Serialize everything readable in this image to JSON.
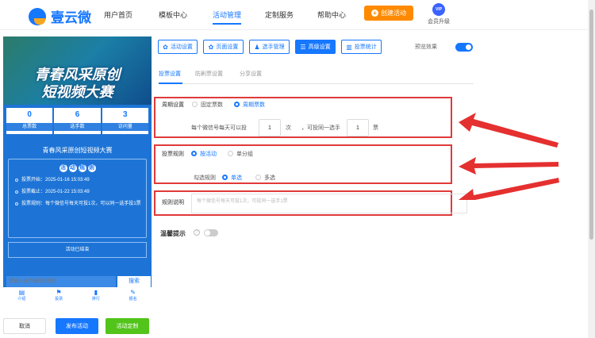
{
  "brand": {
    "name": "壹云微"
  },
  "nav": [
    {
      "label": "用户首页",
      "active": false
    },
    {
      "label": "模板中心",
      "active": false
    },
    {
      "label": "活动管理",
      "active": true
    },
    {
      "label": "定制服务",
      "active": false
    },
    {
      "label": "帮助中心",
      "active": false
    }
  ],
  "create_button": "创建活动",
  "vip": {
    "badge": "VIP",
    "label": "会员升级"
  },
  "preview": {
    "banner_line1": "青春风采原创",
    "banner_line2": "短视频大赛",
    "stats": [
      {
        "value": "0",
        "label": "总票数"
      },
      {
        "value": "6",
        "label": "选手数"
      },
      {
        "value": "3",
        "label": "访问量"
      }
    ],
    "activity_title": "青春风采原创短视频大赛",
    "rules_heading": [
      "活",
      "动",
      "规",
      "则"
    ],
    "rules": [
      "投票开始：2025-01-16 15:03:49",
      "投票截止：2025-01-22 15:03:49",
      "投票规则：每个微信号每天可投1次，可以同一选手投1票"
    ],
    "ended_text": "活动已结束",
    "search_placeholder": "请输入选手编号或名称",
    "search_button": "搜索",
    "bottom_nav": [
      {
        "icon": "▤",
        "label": "介绍"
      },
      {
        "icon": "⚑",
        "label": "投票"
      },
      {
        "icon": "▮",
        "label": "排行"
      },
      {
        "icon": "✎",
        "label": "报名"
      }
    ]
  },
  "actions": {
    "cancel": "取消",
    "publish": "发布活动",
    "customize": "活动定制"
  },
  "tabs": [
    {
      "label": "活动设置",
      "icon": "✿",
      "selected": false
    },
    {
      "label": "页面设置",
      "icon": "✿",
      "selected": false
    },
    {
      "label": "选手管理",
      "icon": "♟",
      "selected": false
    },
    {
      "label": "高级设置",
      "icon": "☰",
      "selected": true
    },
    {
      "label": "投票统计",
      "icon": "▥",
      "selected": false
    }
  ],
  "preview_toggle_label": "预览效果",
  "subtabs": [
    {
      "label": "投票设置",
      "selected": true
    },
    {
      "label": "防刷票设置",
      "selected": false
    },
    {
      "label": "分享设置",
      "selected": false
    }
  ],
  "cycle": {
    "label": "周期设置",
    "options": [
      {
        "label": "固定票数",
        "selected": false
      },
      {
        "label": "周期票数",
        "selected": true
      }
    ],
    "row": {
      "prefix": "每个微信号每天可以投",
      "count1": "1",
      "mid": "次",
      "prefix2": "，可投同一选手",
      "count2": "1",
      "suffix": "票"
    }
  },
  "vote_rule": {
    "label": "投票规则",
    "options": [
      {
        "label": "按活动",
        "selected": true
      },
      {
        "label": "单分组",
        "selected": false
      }
    ],
    "check_label": "勾选规则",
    "check_options": [
      {
        "label": "单选",
        "selected": true
      },
      {
        "label": "多选",
        "selected": false
      }
    ]
  },
  "description": {
    "label": "规则说明",
    "placeholder": "每个微信号每天可投1次，可投同一选手1票"
  },
  "tip": {
    "label": "温馨提示",
    "help": "?"
  }
}
